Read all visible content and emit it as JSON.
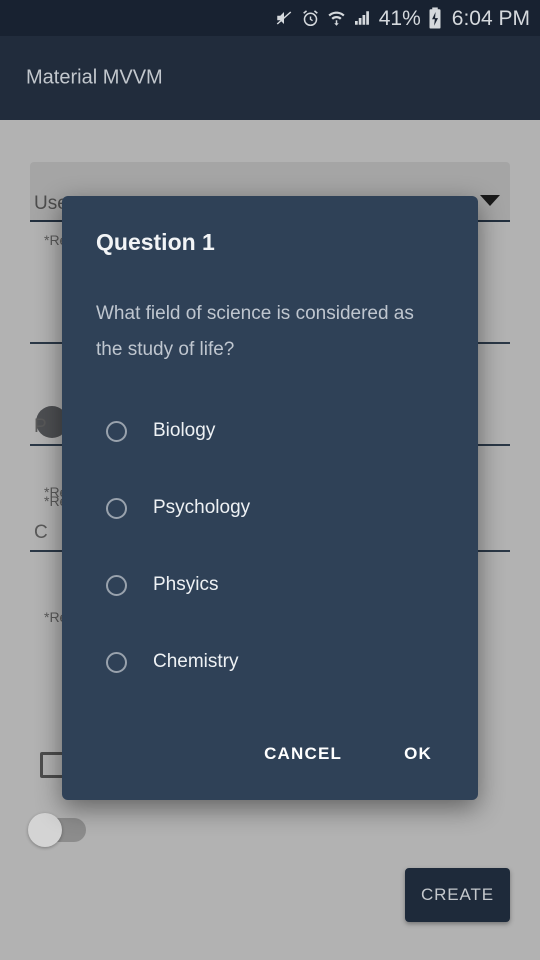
{
  "status_bar": {
    "icons": [
      "volume-mute-icon",
      "alarm-clock-icon",
      "wifi-icon",
      "cellular-signal-icon"
    ],
    "battery_percent": "41%",
    "battery_icon": "battery-charging-icon",
    "time": "6:04 PM"
  },
  "app_bar": {
    "title": "Material MVVM",
    "background_color": "#212c3c"
  },
  "background_form": {
    "dropdown": {
      "label": "Username",
      "arrow_icon": "chevron-down-icon"
    },
    "helpers": {
      "h1": "*Required",
      "h2": "*Required",
      "h3": "*Required",
      "h4": "*Required"
    },
    "fields": {
      "f2": "P",
      "f3": "C"
    },
    "create_button": "CREATE",
    "create_button_color": "#1e2a3a"
  },
  "dialog": {
    "title": "Question 1",
    "message": "What field of science is considered as the study of life?",
    "background_color": "#2f4157",
    "options": [
      {
        "label": "Biology",
        "selected": false
      },
      {
        "label": "Psychology",
        "selected": false
      },
      {
        "label": "Phsyics",
        "selected": false
      },
      {
        "label": "Chemistry",
        "selected": false
      }
    ],
    "cancel_label": "CANCEL",
    "ok_label": "OK"
  }
}
